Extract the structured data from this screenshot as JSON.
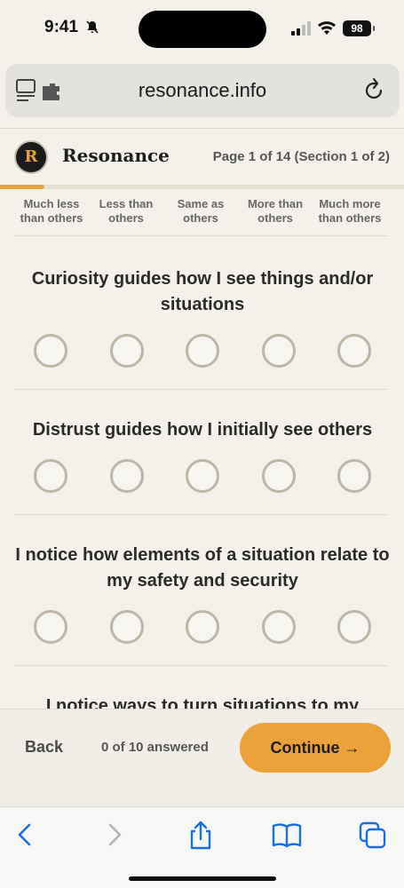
{
  "status_bar": {
    "time": "9:41",
    "battery": "98"
  },
  "browser": {
    "url": "resonance.info"
  },
  "header": {
    "logo_letter": "R",
    "brand": "Resonance",
    "page_indicator": "Page 1 of 14 (Section 1 of 2)",
    "progress_fraction": 0.11
  },
  "scale": {
    "labels": [
      "Much less than others",
      "Less than others",
      "Same as others",
      "More than others",
      "Much more than others"
    ]
  },
  "questions": [
    {
      "text": "Curiosity guides how I see things and/or situations"
    },
    {
      "text": "Distrust guides how I initially see others"
    },
    {
      "text": "I notice how elements of a situation relate to my safety and security"
    },
    {
      "text": "I notice ways to turn situations to my advantage"
    }
  ],
  "footer": {
    "back_label": "Back",
    "answered": "0 of 10 answered",
    "continue_label": "Continue →"
  },
  "colors": {
    "accent": "#eba23a",
    "background": "#f4f1ea"
  },
  "toolbar_icons": [
    "back-icon",
    "forward-icon",
    "share-icon",
    "bookmarks-icon",
    "tabs-icon"
  ]
}
